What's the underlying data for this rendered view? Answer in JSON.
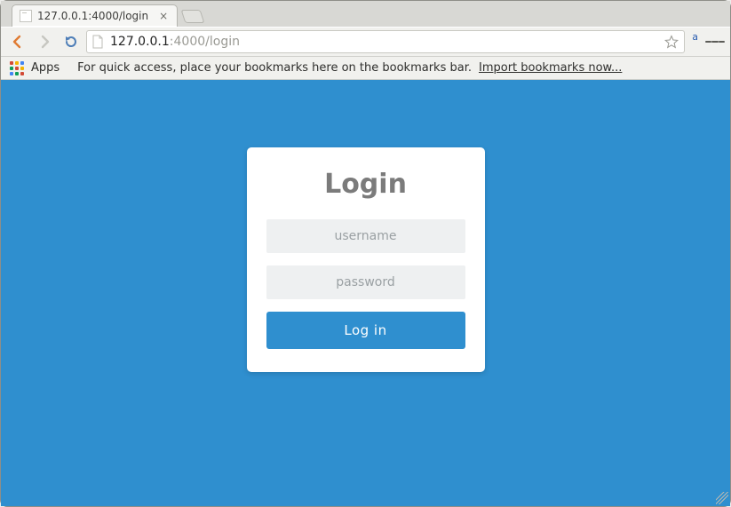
{
  "window": {
    "minimize_name": "minimize",
    "maximize_name": "maximize",
    "close_name": "close"
  },
  "tab": {
    "title": "127.0.0.1:4000/login"
  },
  "toolbar": {
    "url_host": "127.0.0.1",
    "url_rest": ":4000/login",
    "superscript": "a"
  },
  "bookmarks": {
    "apps_label": "Apps",
    "hint_text": "For quick access, place your bookmarks here on the bookmarks bar.",
    "import_link": "Import bookmarks now..."
  },
  "login": {
    "title": "Login",
    "username_placeholder": "username",
    "password_placeholder": "password",
    "submit_label": "Log in"
  },
  "apps_icon_colors": [
    "#d24a35",
    "#f4b400",
    "#4285f4",
    "#0f9d58",
    "#d24a35",
    "#f4b400",
    "#4285f4",
    "#0f9d58",
    "#d24a35"
  ]
}
